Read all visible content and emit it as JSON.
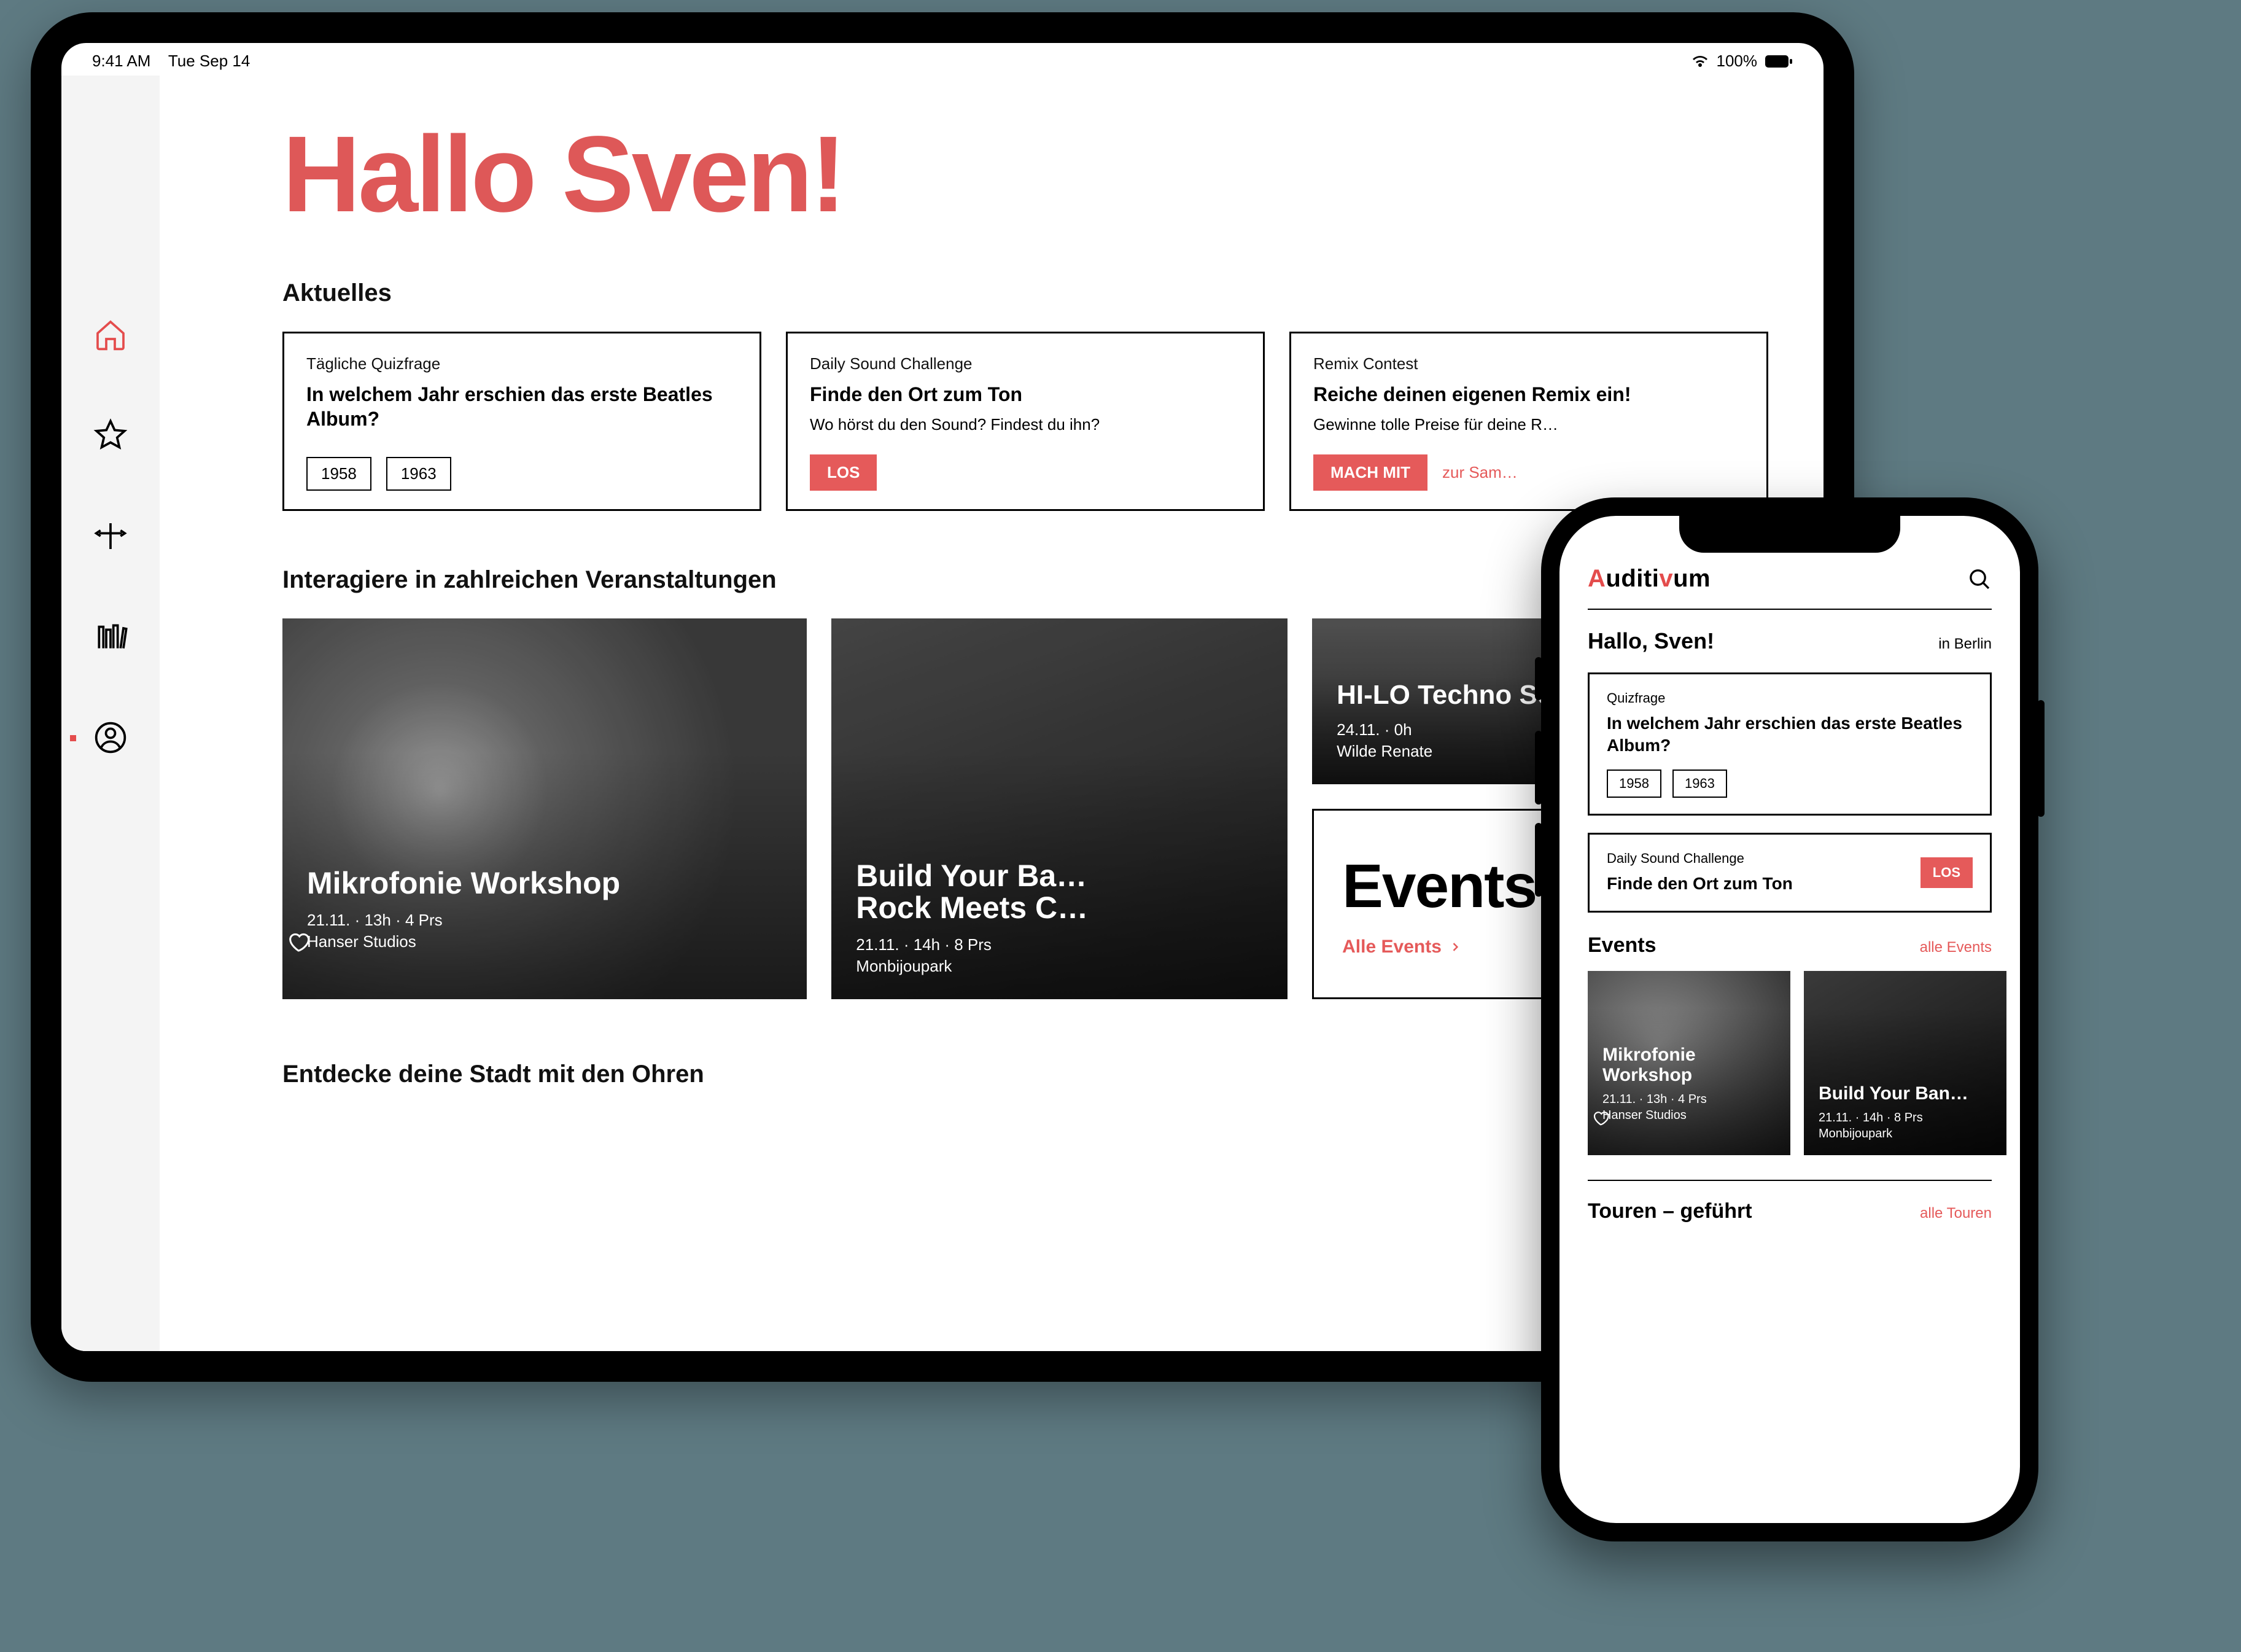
{
  "colors": {
    "accent": "#e44c4c",
    "accent_btn": "#e55a5a"
  },
  "ipad": {
    "statusbar": {
      "time": "9:41 AM",
      "date": "Tue Sep 14",
      "battery": "100%"
    },
    "sidebar": {
      "items": [
        {
          "name": "home",
          "active": true
        },
        {
          "name": "favorites",
          "active": false
        },
        {
          "name": "explore",
          "active": false
        },
        {
          "name": "library",
          "active": false
        },
        {
          "name": "profile",
          "active": false,
          "dot": true
        }
      ]
    },
    "greeting": "Hallo Sven!",
    "sections": {
      "aktuelles": {
        "title": "Aktuelles",
        "cards": [
          {
            "eyebrow": "Tägliche Quizfrage",
            "headline": "In welchem Jahr erschien das erste Beatles Album?",
            "options": [
              "1958",
              "1963"
            ]
          },
          {
            "eyebrow": "Daily Sound Challenge",
            "headline": "Finde den Ort zum Ton",
            "sub": "Wo hörst du den Sound? Findest du ihn?",
            "button": "LOS"
          },
          {
            "eyebrow": "Remix Contest",
            "headline": "Reiche deinen eigenen Remix ein!",
            "sub": "Gewinne tolle Preise für deine R…",
            "button": "MACH MIT",
            "link": "zur Sam…"
          }
        ]
      },
      "interagiere": {
        "title": "Interagiere in zahlreichen Veranstaltungen",
        "events_label": "Events",
        "all_events": "Alle Events",
        "tiles": [
          {
            "title": "Mikrofonie Workshop",
            "meta1": "21.11. · 13h · 4 Prs",
            "meta2": "Hanser Studios"
          },
          {
            "title": "HI-LO Techno Set",
            "meta1": "24.11. · 0h",
            "meta2": "Wilde Renate"
          },
          {
            "title": "Build Your Ba…\nRock Meets C…",
            "meta1": "21.11. · 14h · 8 Prs",
            "meta2": "Monbijoupark"
          }
        ]
      },
      "entdecke": {
        "title": "Entdecke deine Stadt mit den Ohren"
      }
    }
  },
  "iphone": {
    "logo": {
      "full": "Auditivum"
    },
    "greeting": "Hallo, Sven!",
    "location": "in Berlin",
    "quiz": {
      "eyebrow": "Quizfrage",
      "headline": "In welchem Jahr erschien das erste Beatles Album?",
      "options": [
        "1958",
        "1963"
      ]
    },
    "challenge": {
      "eyebrow": "Daily Sound Challenge",
      "headline": "Finde den Ort zum Ton",
      "button": "LOS"
    },
    "events": {
      "title": "Events",
      "link": "alle Events",
      "items": [
        {
          "title": "Mikrofonie Workshop",
          "meta1": "21.11. · 13h · 4 Prs",
          "meta2": "Hanser Studios"
        },
        {
          "title": "Build Your Ban…",
          "meta1": "21.11. · 14h · 8 Prs",
          "meta2": "Monbijoupark"
        }
      ]
    },
    "tours": {
      "title": "Touren – geführt",
      "link": "alle Touren"
    }
  }
}
